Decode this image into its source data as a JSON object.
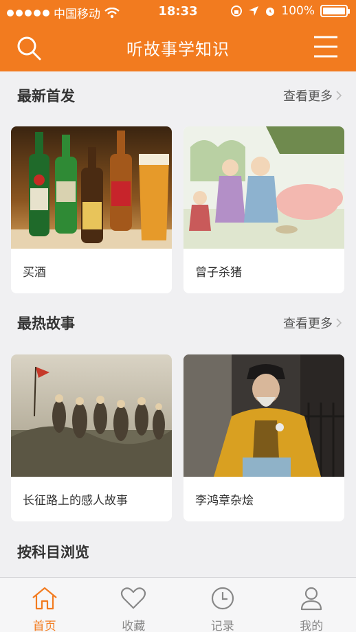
{
  "status_bar": {
    "carrier": "中国移动",
    "time": "18:33",
    "battery": "100%"
  },
  "nav": {
    "title": "听故事学知识"
  },
  "sections": [
    {
      "title": "最新首发",
      "more": "查看更多",
      "cards": [
        {
          "caption": "买酒",
          "image": "beer-bottles-photo"
        },
        {
          "caption": "曾子杀猪",
          "image": "illustration-family-pig"
        }
      ]
    },
    {
      "title": "最热故事",
      "more": "查看更多",
      "cards": [
        {
          "caption": "长征路上的感人故事",
          "image": "painting-long-march"
        },
        {
          "caption": "李鸿章杂烩",
          "image": "portrait-li-hongzhang"
        }
      ]
    },
    {
      "title": "按科目浏览"
    }
  ],
  "tabbar": {
    "items": [
      {
        "label": "首页",
        "icon": "home-icon",
        "active": true
      },
      {
        "label": "收藏",
        "icon": "heart-icon",
        "active": false
      },
      {
        "label": "记录",
        "icon": "clock-icon",
        "active": false
      },
      {
        "label": "我的",
        "icon": "user-icon",
        "active": false
      }
    ]
  },
  "colors": {
    "accent": "#f27b1f",
    "background": "#f0f0f2",
    "tab_inactive": "#888888"
  }
}
